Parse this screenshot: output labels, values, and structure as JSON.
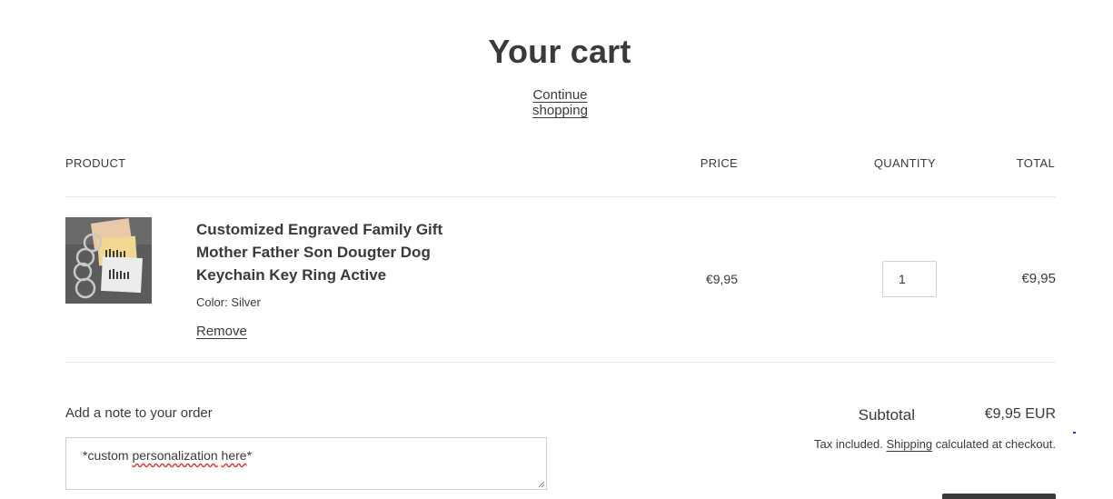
{
  "cart": {
    "title": "Your cart",
    "continue_shopping": "Continue shopping"
  },
  "table": {
    "headers": {
      "product": "PRODUCT",
      "price": "PRICE",
      "quantity": "QUANTITY",
      "total": "TOTAL"
    }
  },
  "item": {
    "title": "Customized Engraved Family Gift Mother Father Son Dougter Dog Keychain Key Ring Active",
    "variant_label": "Color:",
    "variant_value": "Silver",
    "remove_label": "Remove",
    "price": "€9,95",
    "quantity": "1",
    "total": "€9,95",
    "image_icon": "product-thumbnail-keychains"
  },
  "note": {
    "label": "Add a note to your order",
    "value_parts": [
      "*custom ",
      "personalization",
      " ",
      "here",
      "*"
    ]
  },
  "summary": {
    "subtotal_label": "Subtotal",
    "subtotal_value": "€9,95 EUR",
    "tax_prefix": "Tax included.",
    "shipping_link": "Shipping",
    "tax_suffix": "calculated at checkout."
  },
  "colors": {
    "text": "#3a3a3a",
    "border": "#cfcfcf",
    "divider": "#e8e8e8",
    "button": "#3a3a3a",
    "spellcheck": "#dd3333"
  }
}
